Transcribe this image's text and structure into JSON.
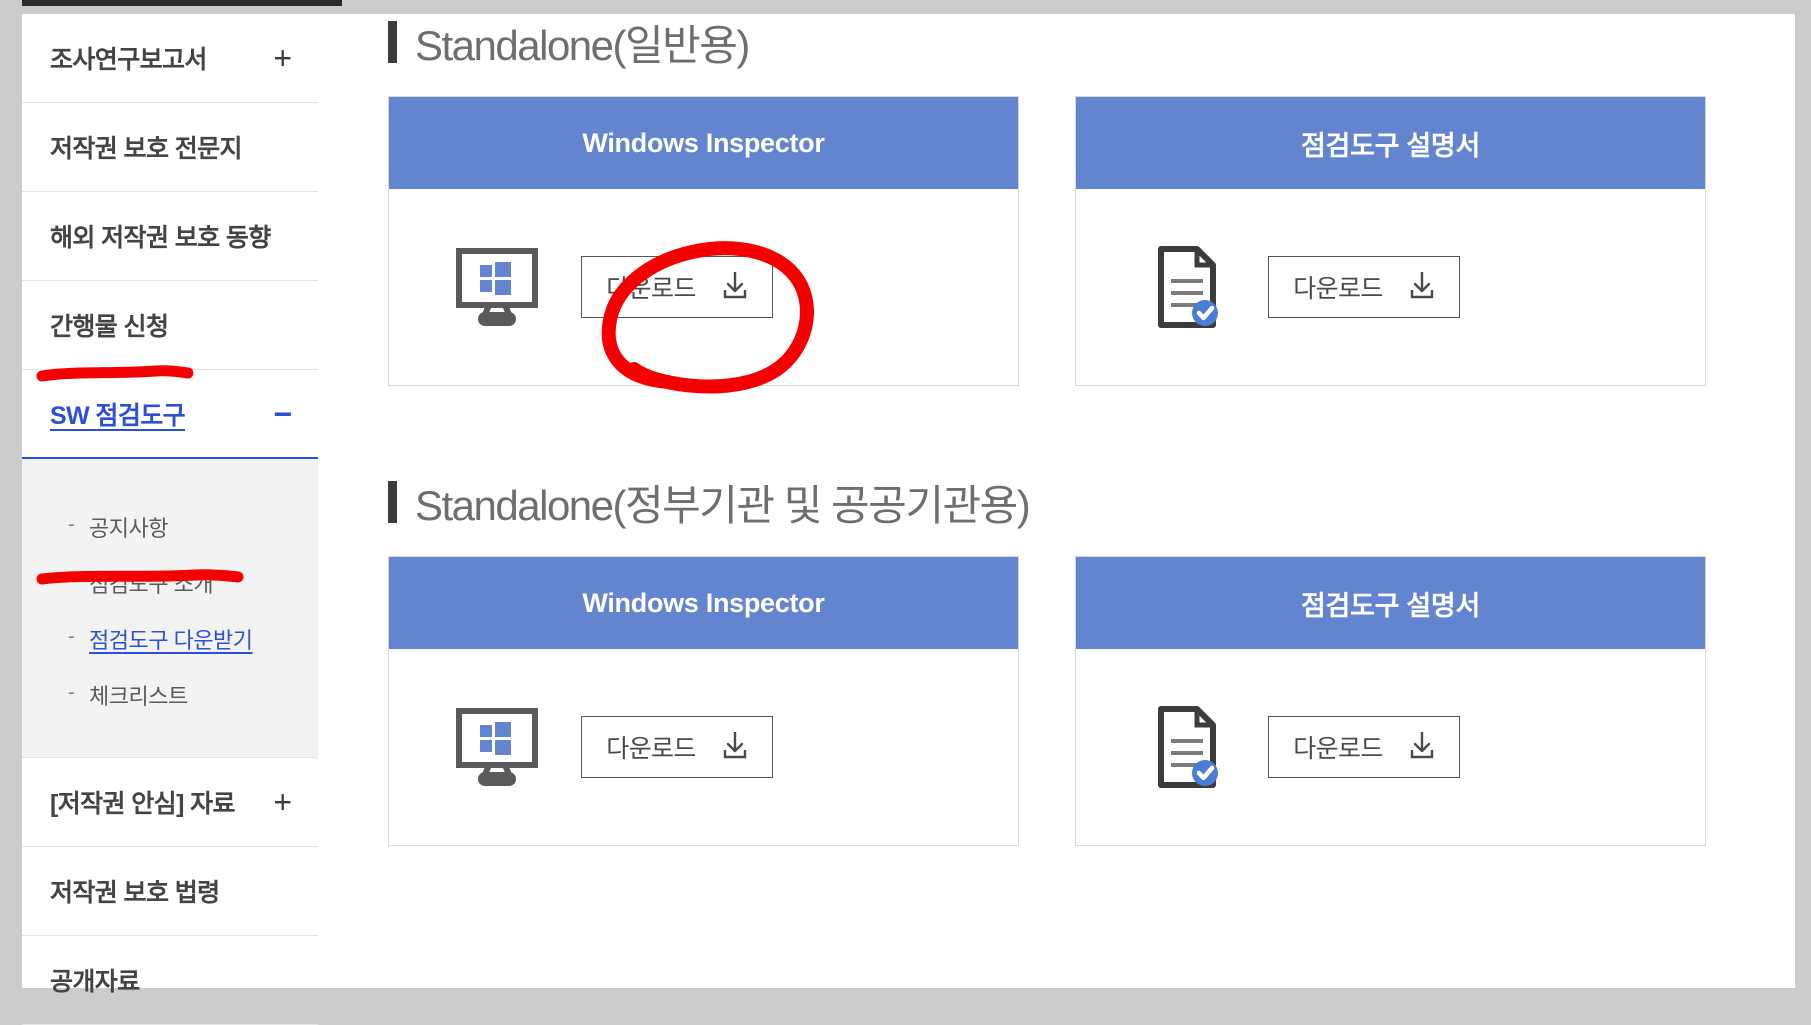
{
  "sidebar": {
    "items": [
      {
        "label": "조사연구보고서",
        "sign": "+",
        "active": false,
        "expanded": false
      },
      {
        "label": "저작권 보호 전문지",
        "sign": "",
        "active": false,
        "expanded": false
      },
      {
        "label": "해외 저작권 보호 동향",
        "sign": "",
        "active": false,
        "expanded": false
      },
      {
        "label": "간행물 신청",
        "sign": "",
        "active": false,
        "expanded": false
      },
      {
        "label": "SW 점검도구",
        "sign": "−",
        "active": true,
        "expanded": true
      },
      {
        "label": "[저작권 안심] 자료",
        "sign": "+",
        "active": false,
        "expanded": false
      },
      {
        "label": "저작권 보호 법령",
        "sign": "",
        "active": false,
        "expanded": false
      },
      {
        "label": "공개자료",
        "sign": "",
        "active": false,
        "expanded": false
      }
    ],
    "submenu": [
      {
        "dash": "-",
        "label": "공지사항",
        "active": false
      },
      {
        "dash": "-",
        "label": "점검도구 소개",
        "active": false
      },
      {
        "dash": "-",
        "label": "점검도구 다운받기",
        "active": true
      },
      {
        "dash": "-",
        "label": "체크리스트",
        "active": false
      }
    ]
  },
  "main": {
    "sections": [
      {
        "title": "Standalone(일반용)",
        "cards": [
          {
            "title": "Windows Inspector",
            "icon": "windows-monitor-icon",
            "button": "다운로드",
            "button_icon": "download-arrow-icon",
            "annotated": true
          },
          {
            "title": "점검도구 설명서",
            "icon": "document-check-icon",
            "button": "다운로드",
            "button_icon": "download-arrow-icon",
            "annotated": false
          }
        ]
      },
      {
        "title": "Standalone(정부기관 및 공공기관용)",
        "cards": [
          {
            "title": "Windows Inspector",
            "icon": "windows-monitor-icon",
            "button": "다운로드",
            "button_icon": "download-arrow-icon",
            "annotated": false
          },
          {
            "title": "점검도구 설명서",
            "icon": "document-check-icon",
            "button": "다운로드",
            "button_icon": "download-arrow-icon",
            "annotated": false
          }
        ]
      }
    ]
  },
  "annotations": {
    "marker_color": "#f40000",
    "items": [
      {
        "name": "circle-around-download-button",
        "shape": "ellipse"
      },
      {
        "name": "underline-sw-inspection-tool",
        "shape": "line"
      },
      {
        "name": "underline-download-inspection-tool",
        "shape": "line"
      }
    ]
  },
  "colors": {
    "card_header": "#6384ce",
    "accent_link": "#2b50d8",
    "page_background": "#ccccca",
    "marker_red": "#f40000"
  }
}
